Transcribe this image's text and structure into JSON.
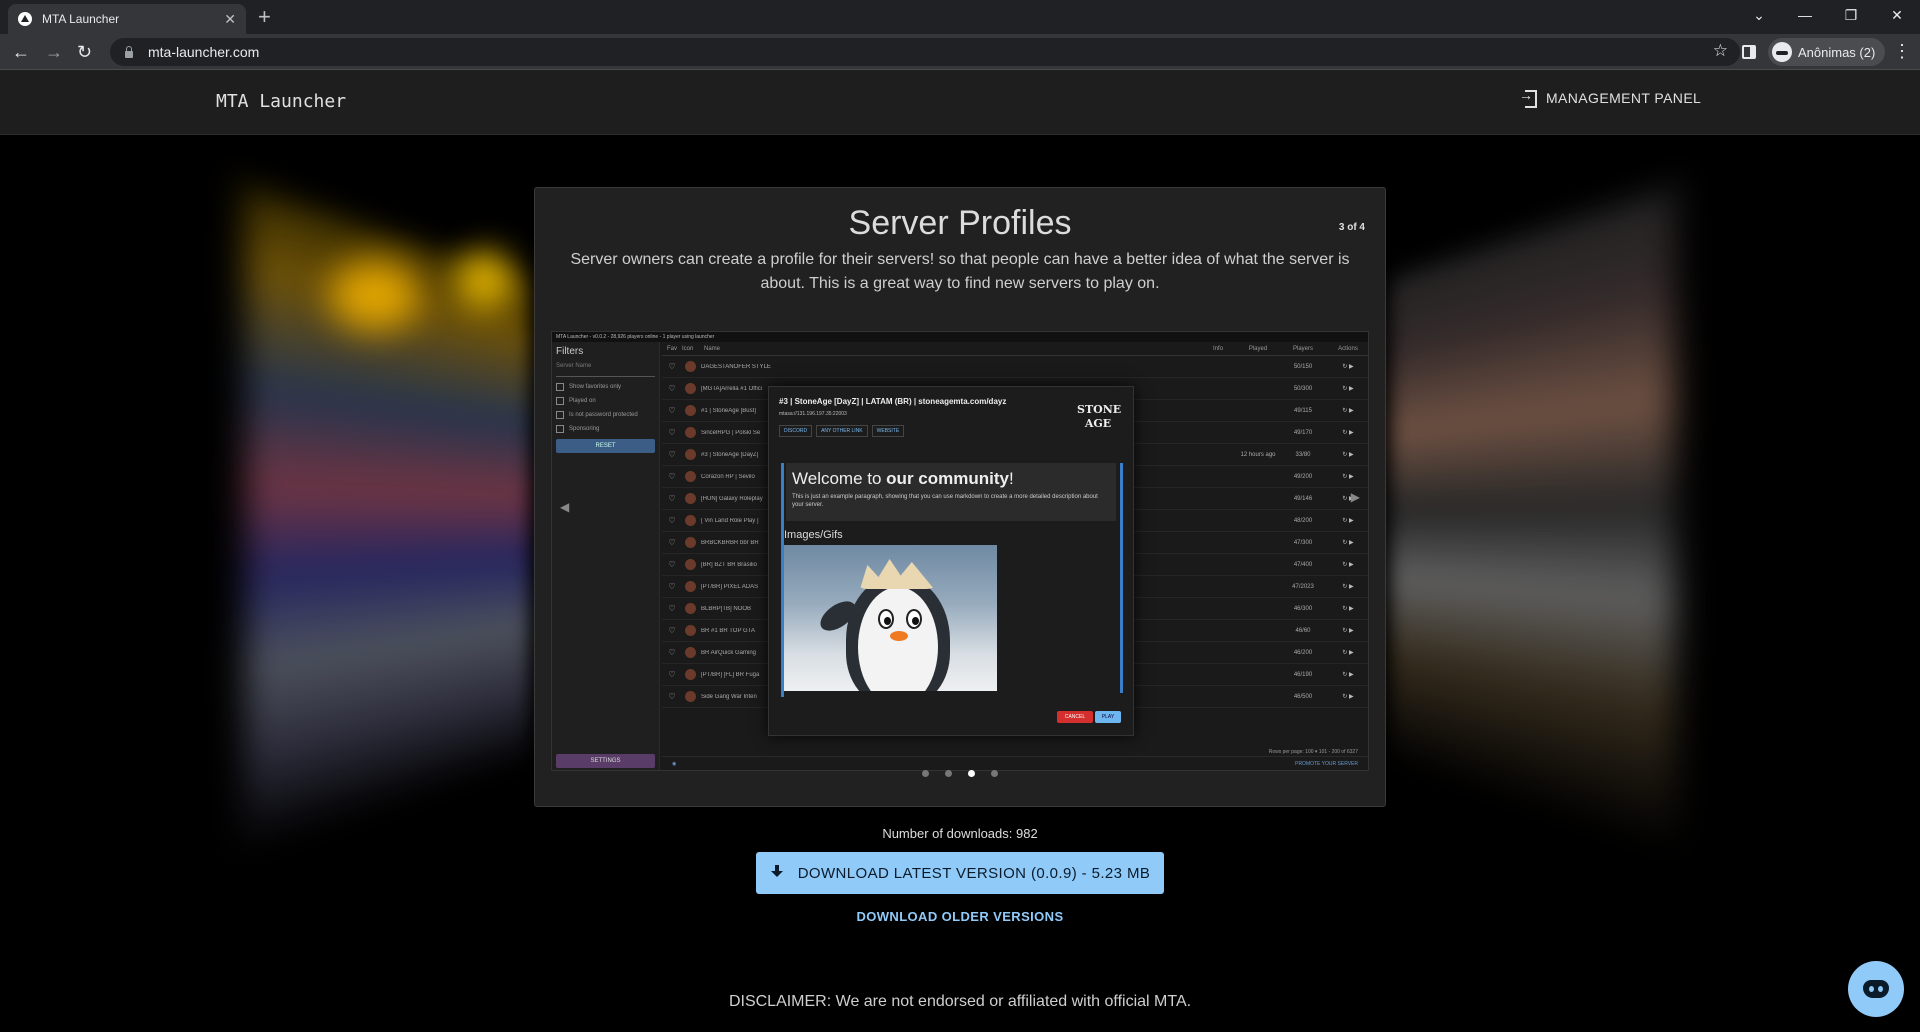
{
  "browser": {
    "tab_title": "MTA Launcher",
    "tab_close": "✕",
    "new_tab": "+",
    "url": "mta-launcher.com",
    "profile_label": "Anônimas (2)",
    "window_controls": [
      "⌄",
      "—",
      "❐",
      "✕"
    ]
  },
  "header": {
    "logo": "MTA Launcher",
    "management_panel": "MANAGEMENT PANEL"
  },
  "carousel": {
    "title": "Server Profiles",
    "counter": "3 of 4",
    "description": "Server owners can create a profile for their servers! so that people can have a better idea of what the server is about. This is a great way to find new servers to play on.",
    "active_index": 3,
    "total": 4
  },
  "screenshot": {
    "window_title": "MTA Launcher - v0.0.2 - 28,926 players online - 1 player using launcher",
    "filters_title": "Filters",
    "server_name_placeholder": "Server Name",
    "checks": [
      "Show favorites only",
      "Played on",
      "Is not password protected",
      "Sponsoring"
    ],
    "reset": "RESET",
    "settings": "SETTINGS",
    "columns": [
      "Fav",
      "Icon",
      "Name",
      "Info",
      "Played",
      "Players",
      "Actions"
    ],
    "rows": [
      {
        "name": "DAGESTANOFER STYLE ORIGINAL [MTA]",
        "played": "",
        "players": "50/150"
      },
      {
        "name": "[MGTA]Arrella #1 Offici",
        "played": "",
        "players": "50/300"
      },
      {
        "name": "#1 | StoneAge [Bust]",
        "played": "",
        "players": "49/115"
      },
      {
        "name": "SincelRPG | Polskl Se",
        "played": "",
        "players": "49/170"
      },
      {
        "name": "#3 | StoneAge [DayZ]",
        "played": "12 hours ago",
        "players": "33/80"
      },
      {
        "name": "Corazon RP | Sevilo",
        "played": "",
        "players": "49/200"
      },
      {
        "name": "[HUN] Galaxy Roleplay",
        "played": "",
        "players": "49/146"
      },
      {
        "name": "[ Vin Land Role Play ]",
        "played": "",
        "players": "48/200"
      },
      {
        "name": "BRBCKBRBR bbr BR",
        "played": "",
        "players": "47/300"
      },
      {
        "name": "[BR] BZT BR Brasilio",
        "played": "",
        "players": "47/400"
      },
      {
        "name": "[PT/BR] PIXEL ADAS",
        "played": "",
        "players": "47/2023"
      },
      {
        "name": "BLBRP[TB] NOOB",
        "played": "",
        "players": "46/300"
      },
      {
        "name": "BR #1 BR TOP GTA",
        "played": "",
        "players": "46/60"
      },
      {
        "name": "BR AirQuick Gaming",
        "played": "",
        "players": "46/200"
      },
      {
        "name": "[PT/BR] [FL] BR Fuga",
        "played": "",
        "players": "46/190"
      },
      {
        "name": "Side Gang War Inten",
        "played": "",
        "players": "46/500"
      }
    ],
    "pagination": "Rows per page: 100 ▾    101 - 200 of 6327",
    "promote": "PROMOTE YOUR SERVER",
    "modal": {
      "title": "#3 | StoneAge [DayZ] | LATAM (BR) | stoneagemta.com/dayz",
      "ip": "mtasa://131.196.197.35:22003",
      "links": [
        "DISCORD",
        "ANY OTHER LINK",
        "WEBSITE"
      ],
      "logo_text": "STONE AGE",
      "welcome_prefix": "Welcome to ",
      "welcome_bold": "our community",
      "welcome_suffix": "!",
      "paragraph": "This is just an example paragraph, showing that you can use markdown to create a more detailed description about your server.",
      "images_heading": "Images/Gifs",
      "cancel": "CANCEL",
      "play": "PLAY"
    }
  },
  "downloads": {
    "count_text": "Number of downloads: 982",
    "latest_label": "DOWNLOAD LATEST VERSION (0.0.9) - 5.23 MB",
    "older_label": "DOWNLOAD OLDER VERSIONS"
  },
  "disclaimer": "DISCLAIMER: We are not endorsed or affiliated with official MTA.",
  "colors": {
    "accent": "#90caf9",
    "card_bg": "#212121",
    "header_bg": "#1e1e1e"
  },
  "icons": {
    "back": "←",
    "forward": "→",
    "reload": "↻",
    "star": "☆",
    "menu": "⋮",
    "heart": "♡",
    "play": "▶",
    "refresh": "↻",
    "left_arrow": "◀",
    "right_arrow": "▶"
  }
}
